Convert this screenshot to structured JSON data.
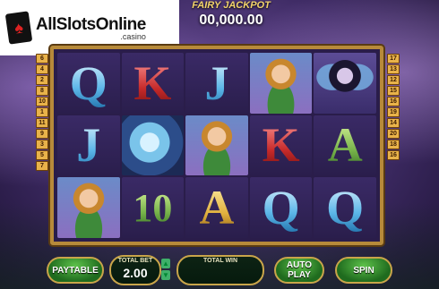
{
  "brand": {
    "main": "AllSlotsOnline",
    "sub": ".casino"
  },
  "jackpot": {
    "label": "FAIRY JACKPOT",
    "value": "00,000.00"
  },
  "paylines_left": [
    "6",
    "4",
    "2",
    "8",
    "10",
    "1",
    "11",
    "9",
    "3",
    "5",
    "7"
  ],
  "paylines_right": [
    "17",
    "13",
    "12",
    "15",
    "16",
    "19",
    "14",
    "20",
    "18",
    "16"
  ],
  "reels": [
    [
      {
        "sym": "Q",
        "style": "blue"
      },
      {
        "sym": "J",
        "style": "blue"
      },
      {
        "sym": "fairy",
        "style": "img"
      }
    ],
    [
      {
        "sym": "K",
        "style": "red"
      },
      {
        "sym": "moon",
        "style": "img"
      },
      {
        "sym": "10",
        "style": "green"
      }
    ],
    [
      {
        "sym": "J",
        "style": "blue"
      },
      {
        "sym": "fairy",
        "style": "img"
      },
      {
        "sym": "A",
        "style": "gold"
      }
    ],
    [
      {
        "sym": "fairy",
        "style": "img"
      },
      {
        "sym": "K",
        "style": "red"
      },
      {
        "sym": "Q",
        "style": "blue"
      }
    ],
    [
      {
        "sym": "darkfairy",
        "style": "img"
      },
      {
        "sym": "A",
        "style": "green"
      },
      {
        "sym": "Q",
        "style": "blue"
      }
    ]
  ],
  "controls": {
    "paytable": "PAYTABLE",
    "total_bet_label": "TOTAL BET",
    "total_bet_value": "2.00",
    "total_win_label": "TOTAL WIN",
    "total_win_value": "",
    "auto_play_line1": "AUTO",
    "auto_play_line2": "PLAY",
    "spin": "SPIN"
  }
}
